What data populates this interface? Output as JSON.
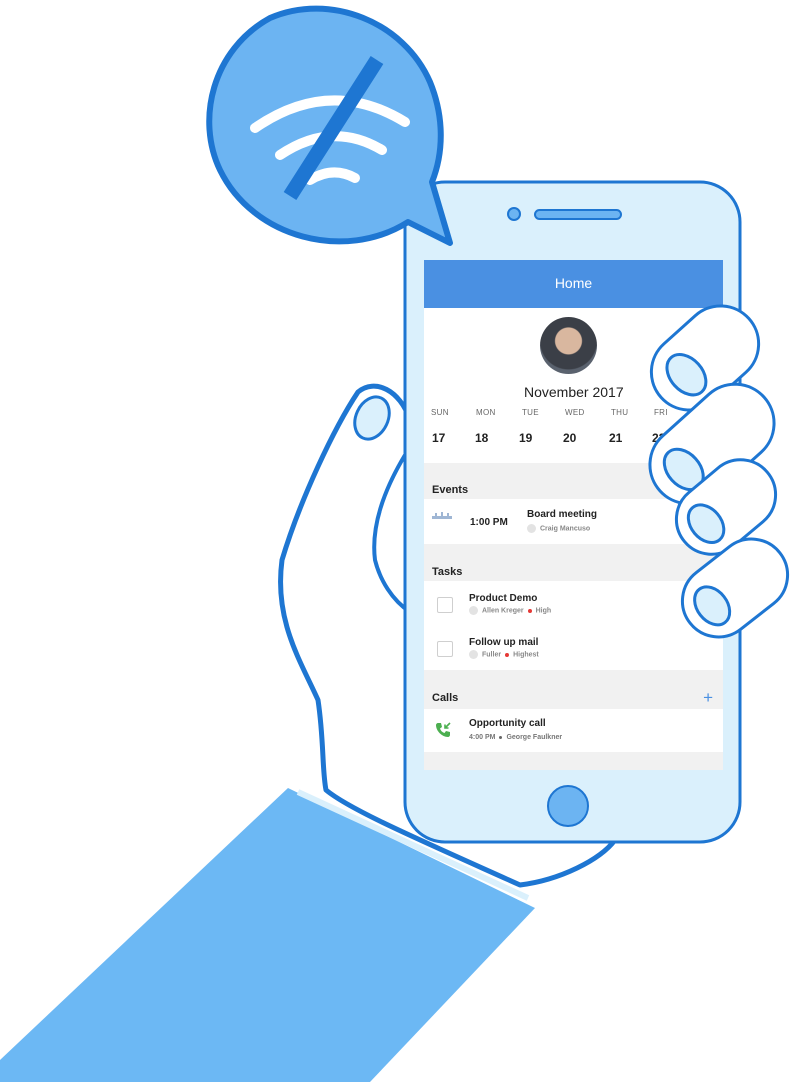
{
  "screen": {
    "title": "Home",
    "month": "November 2017",
    "weekdays": [
      "SUN",
      "MON",
      "TUE",
      "WED",
      "THU",
      "FRI"
    ],
    "dates": [
      "17",
      "18",
      "19",
      "20",
      "21",
      "22"
    ]
  },
  "events": {
    "header": "Events",
    "items": [
      {
        "time": "1:00 PM",
        "title": "Board meeting",
        "owner": "Craig Mancuso"
      }
    ]
  },
  "tasks": {
    "header": "Tasks",
    "items": [
      {
        "title": "Product Demo",
        "owner": "Allen Kreger",
        "priority": "High"
      },
      {
        "title": "Follow up mail",
        "owner": "Fuller",
        "priority": "Highest"
      }
    ]
  },
  "calls": {
    "header": "Calls",
    "add_label": "+",
    "items": [
      {
        "title": "Opportunity call",
        "time": "4:00 PM",
        "contact": "George Faulkner"
      }
    ]
  },
  "icons": {
    "no_wifi": "wifi-off-icon",
    "event": "calendar-bar-icon",
    "call": "incoming-call-icon"
  },
  "colors": {
    "accent": "#4a90e2",
    "bubble": "#6cb4f2",
    "outline": "#1e76d2",
    "phone_body": "#daf0fc",
    "sleeve": "#6cb8f4",
    "priority": "#e53935",
    "call_green": "#4caf50"
  }
}
